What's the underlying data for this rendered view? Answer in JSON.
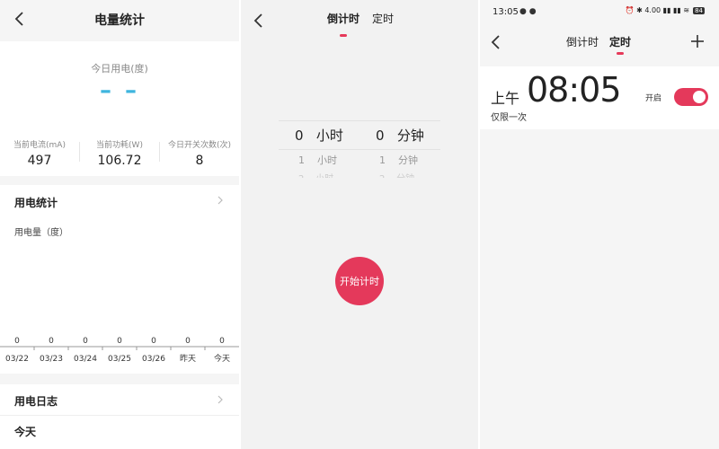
{
  "colors": {
    "accent": "#e4395b",
    "today_value": "#3fb5de"
  },
  "stats_screen": {
    "title": "电量统计",
    "today_label": "今日用电(度)",
    "today_value": "– –",
    "stats": [
      {
        "label": "当前电流(mA)",
        "value": "497"
      },
      {
        "label": "当前功耗(W)",
        "value": "106.72"
      },
      {
        "label": "今日开关次数(次)",
        "value": "8"
      }
    ],
    "usage_section": "用电统计",
    "log_section": "用电日志",
    "log_today": "今天"
  },
  "chart_data": {
    "type": "bar",
    "ylabel": "用电量（度）",
    "categories": [
      "03/22",
      "03/23",
      "03/24",
      "03/25",
      "03/26",
      "昨天",
      "今天"
    ],
    "values": [
      0,
      0,
      0,
      0,
      0,
      0,
      0
    ]
  },
  "countdown_screen": {
    "tabs": [
      {
        "label": "倒计时",
        "active": true
      },
      {
        "label": "定时",
        "active": false
      }
    ],
    "hours": {
      "selected": "0",
      "next": "1",
      "next2": "2",
      "unit": "小时"
    },
    "minutes": {
      "selected": "0",
      "next": "1",
      "next2": "2",
      "unit": "分钟"
    },
    "start_button": "开始计时"
  },
  "timer_screen": {
    "status_time": "13:05",
    "status_icons": "● ●",
    "status_right": "⏰ ✱ 4.00 ▮▮ ▮▮ ≋",
    "battery": "84",
    "tabs": [
      {
        "label": "倒计时",
        "active": false
      },
      {
        "label": "定时",
        "active": true
      }
    ],
    "alarm": {
      "ampm": "上午",
      "time": "08:05",
      "repeat": "仅限一次",
      "enabled_label": "开启",
      "enabled": true
    }
  }
}
